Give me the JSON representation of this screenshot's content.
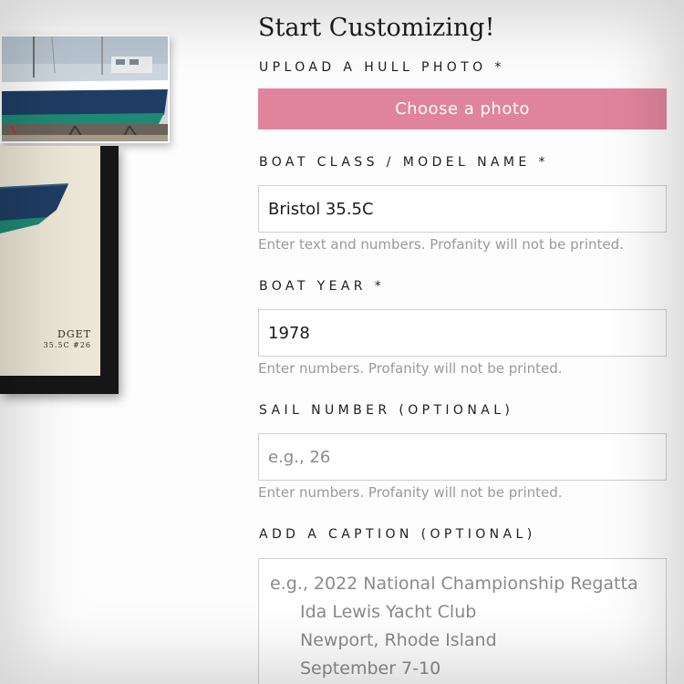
{
  "form": {
    "title": "Start Customizing!",
    "upload": {
      "label": "UPLOAD A HULL PHOTO *",
      "button_label": "Choose a photo"
    },
    "boat_class": {
      "label": "BOAT CLASS / MODEL NAME *",
      "value": "Bristol 35.5C",
      "hint": "Enter text and numbers. Profanity will not be printed."
    },
    "boat_year": {
      "label": "BOAT YEAR *",
      "value": "1978",
      "hint": "Enter numbers. Profanity will not be printed."
    },
    "sail_number": {
      "label": "SAIL NUMBER (OPTIONAL)",
      "placeholder": "e.g., 26",
      "value": "",
      "hint": "Enter numbers. Profanity will not be printed."
    },
    "caption": {
      "label": "ADD A CAPTION (OPTIONAL)",
      "placeholder_lines": [
        "e.g., 2022 National Championship Regatta",
        "Ida Lewis Yacht Club",
        "Newport, Rhode Island",
        "September 7-10"
      ]
    }
  },
  "preview": {
    "print_name_fragment": "DGET",
    "print_model_fragment": "35.5C #26"
  },
  "colors": {
    "accent": "#e0849d",
    "hull_blue": "#1f3d63",
    "hull_green": "#1e8a73",
    "frame": "#161616",
    "mat": "#ebe6d6"
  }
}
